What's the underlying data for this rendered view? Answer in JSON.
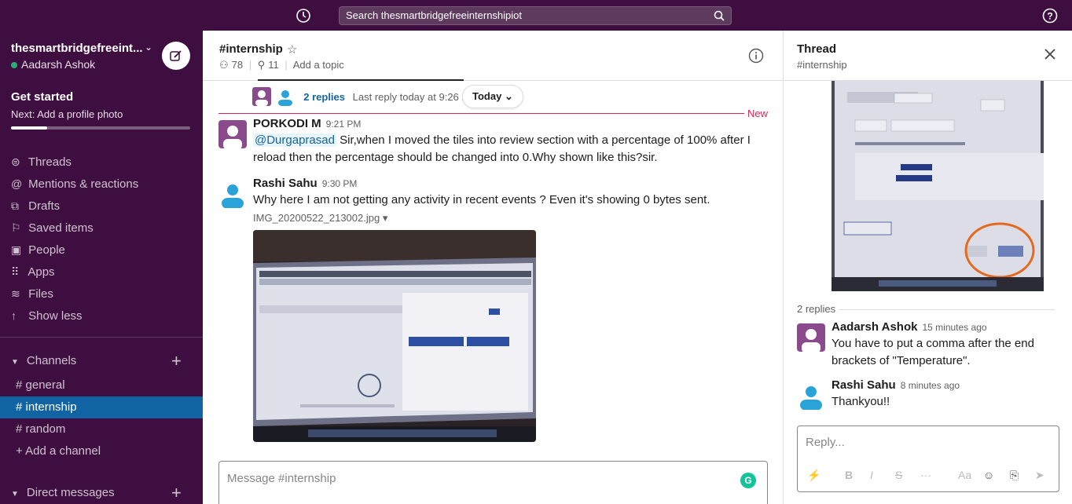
{
  "topbar": {
    "search_placeholder": "Search thesmartbridgefreeinternshipiot",
    "icons": [
      "history-icon",
      "search-icon",
      "help-icon"
    ]
  },
  "sidebar": {
    "workspace_name": "thesmartbridgefreeint...",
    "user_name": "Aadarsh Ashok",
    "get_started": "Get started",
    "get_started_next": "Next: Add a profile photo",
    "progress_fraction": 0.2,
    "nav": [
      {
        "label": "Threads",
        "icon": "threads-icon"
      },
      {
        "label": "Mentions & reactions",
        "icon": "mention-icon"
      },
      {
        "label": "Drafts",
        "icon": "drafts-icon"
      },
      {
        "label": "Saved items",
        "icon": "bookmark-icon"
      },
      {
        "label": "People",
        "icon": "people-icon"
      },
      {
        "label": "Apps",
        "icon": "apps-icon"
      },
      {
        "label": "Files",
        "icon": "files-icon"
      },
      {
        "label": "Show less",
        "icon": "arrow-up-icon"
      }
    ],
    "channels_header": "Channels",
    "channels": [
      {
        "name": "general",
        "prefix": "#"
      },
      {
        "name": "internship",
        "prefix": "#"
      },
      {
        "name": "random",
        "prefix": "#"
      }
    ],
    "add_channel": "Add a channel",
    "add_channel_prefix": "+",
    "dm_header": "Direct messages"
  },
  "channel": {
    "title": "#internship",
    "members": "78",
    "pinned": "11",
    "add_topic": "Add a topic",
    "replies_link": "2 replies",
    "last_reply": "Last reply today at 9:26 PM",
    "today_pill": "Today",
    "new_label": "New",
    "messages": [
      {
        "author": "PORKODI M",
        "time": "9:21 PM",
        "mention": "@Durgaprasad",
        "text": " Sir,when I moved the tiles into review section with a percentage of 100% after I reload then the percentage should be changed into 0.Why shown like this?sir."
      },
      {
        "author": "Rashi Sahu",
        "time": "9:30 PM",
        "text": "Why here I am not getting any activity in recent events ? Even it's showing 0 bytes sent.",
        "file_name": "IMG_20200522_213002.jpg"
      }
    ],
    "composer_placeholder": "Message #internship",
    "grammarly": "G"
  },
  "thread": {
    "title": "Thread",
    "subtitle": "#internship",
    "replies_count": "2 replies",
    "replies": [
      {
        "author": "Aadarsh Ashok",
        "time": "15 minutes ago",
        "text": "You have to put a comma after the end brackets of \"Temperature\"."
      },
      {
        "author": "Rashi Sahu",
        "time": "8 minutes ago",
        "text": "Thankyou!!"
      }
    ],
    "composer_placeholder": "Reply...",
    "toolbar": {
      "bold": "B",
      "italic": "I",
      "strike": "S",
      "more": "···",
      "format": "Aa"
    }
  },
  "colors": {
    "sidebar_bg": "#3f0e40",
    "active_channel": "#1164a3",
    "link": "#1264a3",
    "new_marker": "#e01e5a",
    "presence": "#2bac76"
  }
}
